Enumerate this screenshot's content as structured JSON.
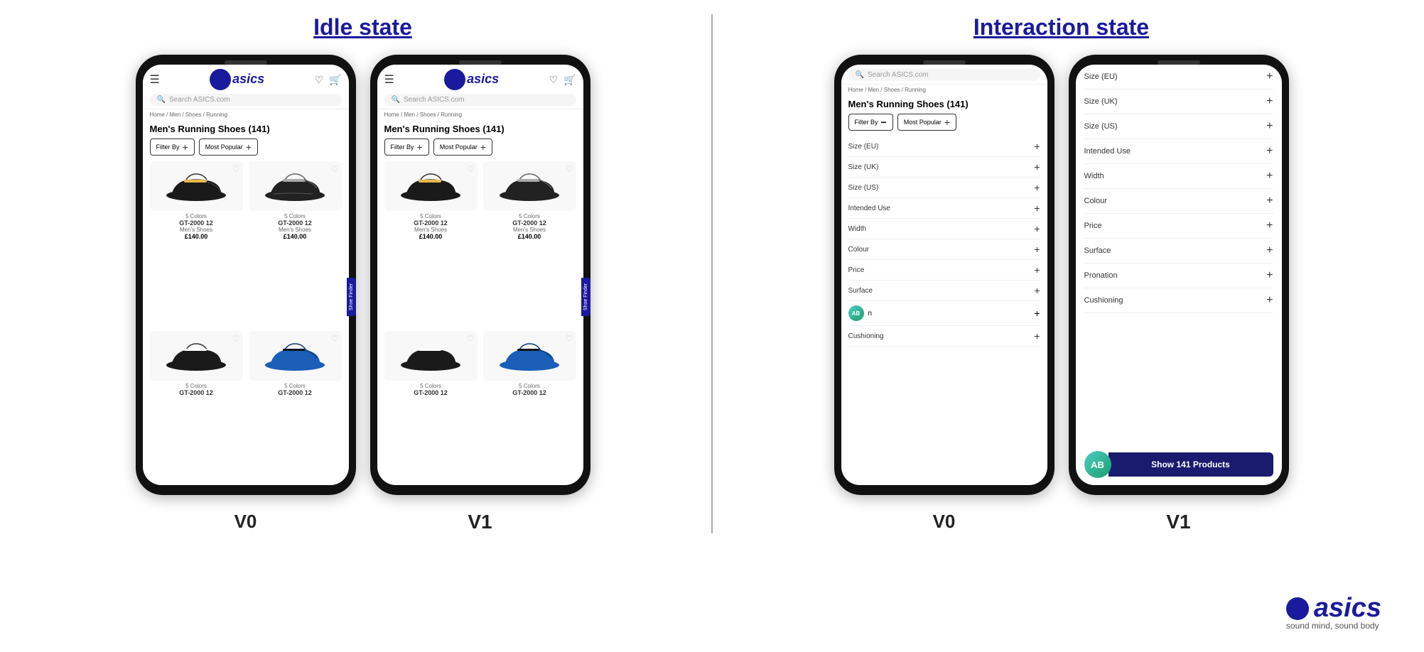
{
  "page": {
    "idle_state_title": "Idle state",
    "interaction_state_title": "Interaction state"
  },
  "v0_idle": {
    "label": "V0",
    "label_weight": "normal",
    "header": {
      "search_placeholder": "Search ASICS.com"
    },
    "breadcrumb": "Home / Men / Shoes / Running",
    "page_title": "Men's Running Shoes (141)",
    "filter_by": "Filter By",
    "most_popular": "Most Popular",
    "products": [
      {
        "colors": "5 Colors",
        "name": "GT-2000 12",
        "category": "Men's Shoes",
        "price": "£140.00",
        "color_type": "black"
      },
      {
        "colors": "5 Colors",
        "name": "GT-2000 12",
        "category": "Men's Shoes",
        "price": "£140.00",
        "color_type": "black_silver"
      },
      {
        "colors": "5 Colors",
        "name": "GT-2000 12",
        "category": "Men's Shoes",
        "price": "",
        "color_type": "black"
      },
      {
        "colors": "5 Colors",
        "name": "GT-2000 12",
        "category": "Men's Shoes",
        "price": "",
        "color_type": "blue"
      }
    ],
    "shoe_finder": "Shoe Finder"
  },
  "v1_idle": {
    "label": "V1",
    "label_weight": "bold",
    "header": {
      "search_placeholder": "Search ASICS.com"
    },
    "breadcrumb": "Home / Men / Shoes / Running",
    "page_title": "Men's Running Shoes (141)",
    "filter_by": "Filter By",
    "most_popular": "Most Popular",
    "products": [
      {
        "colors": "5 Colors",
        "name": "GT-2000 12",
        "category": "Men's Shoes",
        "price": "£140.00",
        "color_type": "black"
      },
      {
        "colors": "5 Colors",
        "name": "GT-2000 12",
        "category": "Men's Shoes",
        "price": "£140.00",
        "color_type": "black_silver"
      },
      {
        "colors": "5 Colors",
        "name": "GT-2000 12",
        "category": "",
        "price": "",
        "color_type": "black"
      },
      {
        "colors": "5 Colors",
        "name": "GT-2000 12",
        "category": "",
        "price": "",
        "color_type": "blue"
      }
    ],
    "shoe_finder": "Shoe Finder"
  },
  "v0_interaction": {
    "label": "V0",
    "label_weight": "normal",
    "header": {
      "search_placeholder": "Search ASICS.com"
    },
    "breadcrumb": "Home / Men / Shoes / Running",
    "page_title": "Men's Running Shoes (141)",
    "filter_by": "Filter By",
    "most_popular": "Most Popular",
    "filters": [
      "Size (EU)",
      "Size (UK)",
      "Size (US)",
      "Intended Use",
      "Width",
      "Colour",
      "Price",
      "Surface",
      "Pronation",
      "Cushioning"
    ],
    "ab_label": "AB",
    "cushioning": "Cushioning"
  },
  "v1_interaction": {
    "label": "V1",
    "label_weight": "bold",
    "filters": [
      "Size (EU)",
      "Size (UK)",
      "Size (US)",
      "Intended Use",
      "Width",
      "Colour",
      "Price",
      "Surface",
      "Pronation",
      "Cushioning"
    ],
    "ab_label": "AB",
    "show_products_text": "Show 141 Products"
  },
  "brand": {
    "logo_text": "asics",
    "tagline": "sound mind, sound body"
  }
}
